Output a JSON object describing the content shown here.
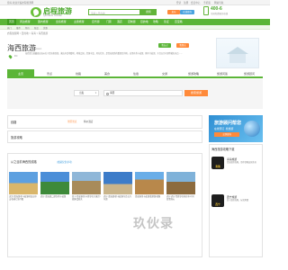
{
  "topbar": {
    "left": "您好,欢迎光临启程旅游网",
    "links": [
      "登录",
      "注册",
      "会员中心",
      "手机版",
      "网站导航"
    ]
  },
  "header": {
    "logo_text": "启程旅游",
    "logo_sub": "QICHENG TRAVEL",
    "search_placeholder": "请输入目的地",
    "search_button": "搜索",
    "btn_a": "发布",
    "btn_b": "在线咨询",
    "hotline": "400-6",
    "hotline_label": "全国免费服务热线"
  },
  "nav": {
    "items": [
      "首页",
      "周边旅游",
      "国内旅游",
      "出境旅游",
      "主题旅游",
      "自驾游",
      "门票",
      "酒店",
      "定制游",
      "目的地",
      "攻略",
      "签证",
      "百宝箱"
    ],
    "sub": [
      "热门",
      "推荐",
      "特价",
      "新品",
      "优惠"
    ]
  },
  "breadcrumb": "启程旅游网 > 目的地 > 青海 > 海西旅游",
  "destination": {
    "title": "海西旅游",
    "title_en": "Haixi",
    "code": "FC",
    "intro": "海西蒙古族藏族自治州位于青海省西部，柴达木盆地腹地，地域辽阔，资源丰富，风光壮美，是青海旅游的重要目的地。这里有茶卡盐湖、察尔汗盐湖、东台吉乃尔湖等著名景点……",
    "btn_been": "我去过",
    "btn_want": "我想去"
  },
  "tabs": [
    "主页",
    "景点",
    "线路",
    "美食",
    "住宿",
    "交通",
    "旅游攻略",
    "旅游问答",
    "旅游顾问"
  ],
  "search": {
    "city": "出发",
    "keyword": "海西",
    "button": "搜索旅游"
  },
  "panels": {
    "lines_title": "线路",
    "lines_links": [
      "景区景点",
      "特价酒店"
    ],
    "guide_title": "旅游攻略",
    "recommend_title": "从之目前海西的线路",
    "recommend_sub": "(线路仅供参考)"
  },
  "routes": [
    "[北京]青海湖/茶卡盐湖/祁连卓尔山/张掖七彩丹霞",
    "[西宁]青海湖二郎剑/茶卡盐湖",
    "西宁/青海湖/茶卡/德令哈/大柴旦/敦煌/嘉峪关",
    "[西宁]青海湖/茶卡盐湖/东台吉乃尔湖",
    "青海湖/茶卡盐湖/翡翠湖/敦煌",
    "[西宁]西宁至德令哈/格尔木/可可西里纯玩"
  ],
  "sidebar": {
    "banner_title": "旅游顾问帮您",
    "banner_sub": "在线预订 ·找旅游",
    "banner_cta": "立即咨询",
    "box_title": "海西旅游攻略下载",
    "apps": [
      {
        "icon_text": "青海",
        "name": "青海旅游",
        "desc": "青海旅游攻略，带你领略高原美景"
      },
      {
        "icon_text": "西宁",
        "name": "西宁旅游",
        "desc": "西宁旅游攻略，玩转夏都"
      }
    ]
  },
  "watermark": "玖伙录",
  "colors": {
    "green": "#5bb537",
    "orange": "#ff8a3a",
    "blue": "#2f8fd3"
  }
}
